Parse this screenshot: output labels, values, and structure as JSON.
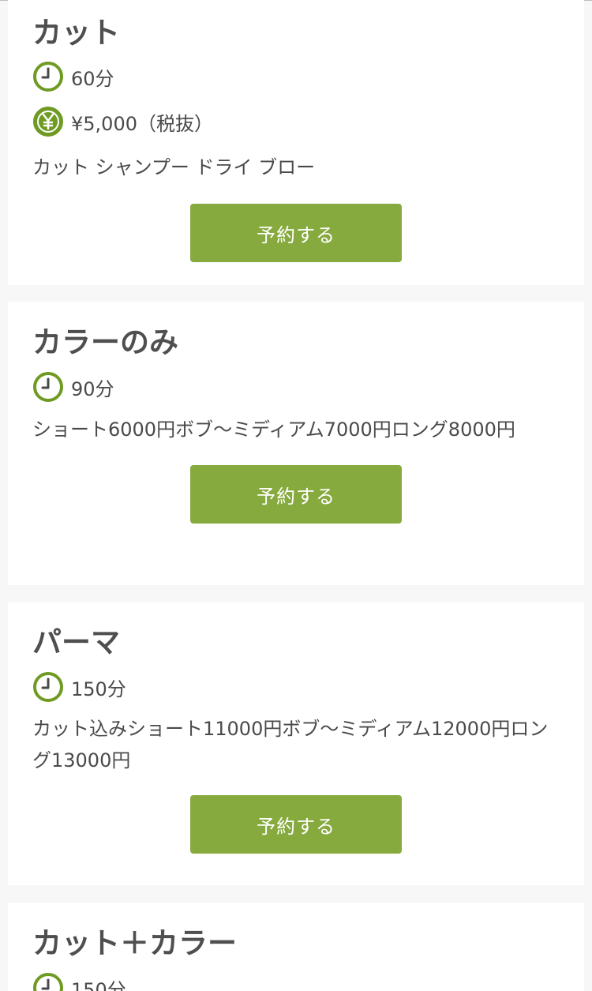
{
  "menus": [
    {
      "title": "カット",
      "duration": "60分",
      "price": "¥5,000（税抜）",
      "description": "カット シャンプー ドライ ブロー",
      "button_label": "予約する"
    },
    {
      "title": "カラーのみ",
      "duration": "90分",
      "description": "ショート6000円ボブ〜ミディアム7000円ロング8000円",
      "button_label": "予約する"
    },
    {
      "title": "パーマ",
      "duration": "150分",
      "description": "カット込みショート11000円ボブ〜ミディアム12000円ロング13000円",
      "button_label": "予約する"
    },
    {
      "title": "カット＋カラー",
      "duration": "150分"
    }
  ],
  "icons": {
    "clock": "clock-icon",
    "yen": "yen-icon"
  },
  "colors": {
    "accent": "#86aa3e",
    "icon_green": "#6f9a23",
    "page_bg": "#f7f7f8",
    "card_bg": "#ffffff",
    "text": "#4a4a4a"
  }
}
